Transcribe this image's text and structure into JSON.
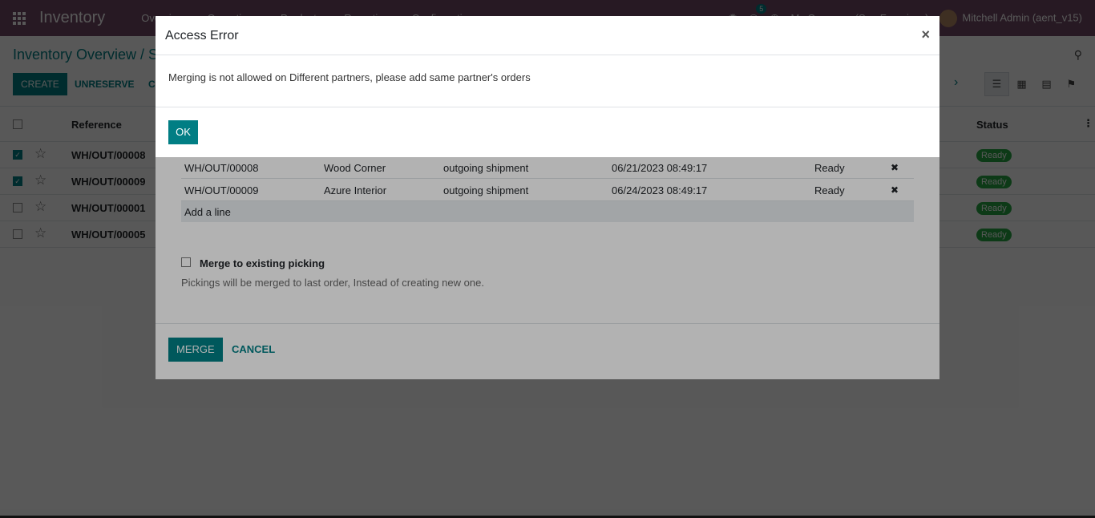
{
  "navbar": {
    "app_name": "Inventory",
    "menu": [
      "Overview",
      "Operations",
      "Products",
      "Reporting",
      "Configuration"
    ],
    "chat_badge": "5",
    "company": "My Company (San Francisco)",
    "user": "Mitchell Admin (aent_v15)"
  },
  "control_panel": {
    "breadcrumb": "Inventory Overview / S",
    "create_label": "CREATE",
    "unreserve_label": "UNRESERVE",
    "c_label": "C"
  },
  "list": {
    "header": {
      "reference": "Reference",
      "status": "Status"
    },
    "rows": [
      {
        "ref": "WH/OUT/00008",
        "status": "Ready",
        "checked": true
      },
      {
        "ref": "WH/OUT/00009",
        "status": "Ready",
        "checked": true
      },
      {
        "ref": "WH/OUT/00001",
        "status": "Ready",
        "checked": false
      },
      {
        "ref": "WH/OUT/00005",
        "status": "Ready",
        "checked": false
      }
    ]
  },
  "wizard": {
    "lines": [
      {
        "ref": "WH/OUT/00008",
        "partner": "Wood Corner",
        "type": "outgoing shipment",
        "date": "06/21/2023 08:49:17",
        "status": "Ready"
      },
      {
        "ref": "WH/OUT/00009",
        "partner": "Azure Interior",
        "type": "outgoing shipment",
        "date": "06/24/2023 08:49:17",
        "status": "Ready"
      }
    ],
    "add_line": "Add a line",
    "merge_existing_label": "Merge to existing picking",
    "merge_help": "Pickings will be merged to last order, Instead of creating new one.",
    "merge_button": "MERGE",
    "cancel_button": "CANCEL"
  },
  "dialog": {
    "title": "Access Error",
    "close": "×",
    "message": "Merging is not allowed on Different partners, please add same partner's orders",
    "ok_button": "OK"
  },
  "colors": {
    "primary": "#017e84",
    "navbar": "#714b67",
    "ready_badge": "#28a745"
  }
}
